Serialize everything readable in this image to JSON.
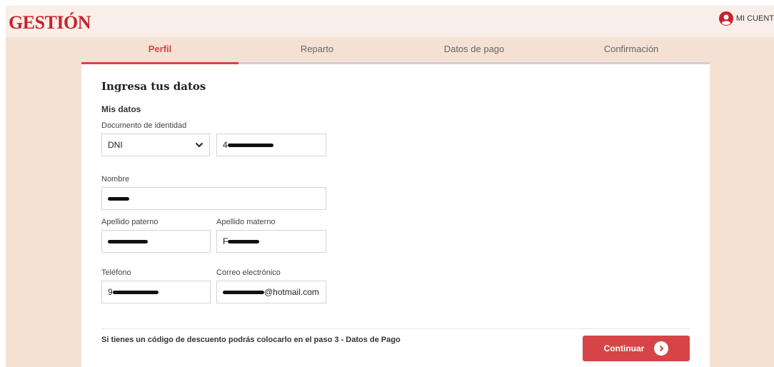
{
  "header": {
    "logo": "GESTIÓN",
    "account_label": "MI CUENT"
  },
  "steps": [
    {
      "label": "Perfil",
      "active": true
    },
    {
      "label": "Reparto",
      "active": false
    },
    {
      "label": "Datos de pago",
      "active": false
    },
    {
      "label": "Confirmación",
      "active": false
    }
  ],
  "form": {
    "title": "Ingresa tus datos",
    "subtitle": "Mis datos",
    "document": {
      "label": "Documento de identidad",
      "type_value": "DNI",
      "number_value": "4"
    },
    "nombre": {
      "label": "Nombre",
      "value": ""
    },
    "apellido_paterno": {
      "label": "Apellido paterno",
      "value": ""
    },
    "apellido_materno": {
      "label": "Apellido materno",
      "value": "F"
    },
    "telefono": {
      "label": "Teléfono",
      "value": "9"
    },
    "correo": {
      "label": "Correo electrónico",
      "value_suffix": "@hotmail.com"
    }
  },
  "footer": {
    "note": "Si tienes un código de descuento podrás colocarlo en el paso 3 - Datos de Pago",
    "continue_label": "Continuar"
  },
  "colors": {
    "brand_red": "#c8202f",
    "accent": "#d64447",
    "peach_bg": "#f5e1d4",
    "header_bg": "#f9efe8"
  }
}
